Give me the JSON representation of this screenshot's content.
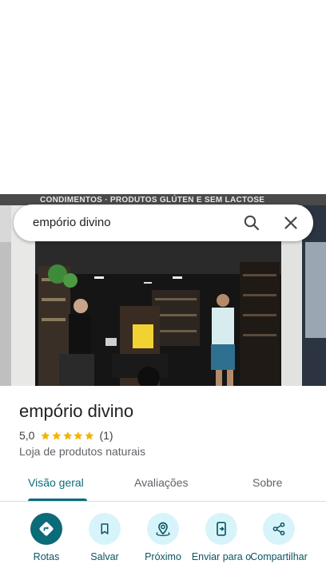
{
  "search": {
    "query": "empório divino"
  },
  "photo": {
    "sign_text": "CONDIMENTOS · PRODUTOS GLÚTEN E SEM LACTOSE"
  },
  "place": {
    "name": "empório divino",
    "rating": "5,0",
    "stars": 5,
    "review_count": "(1)",
    "category": "Loja de produtos naturais"
  },
  "tabs": [
    {
      "label": "Visão geral",
      "active": true
    },
    {
      "label": "Avaliações",
      "active": false
    },
    {
      "label": "Sobre",
      "active": false
    }
  ],
  "actions": [
    {
      "label": "Rotas",
      "icon": "directions-icon"
    },
    {
      "label": "Salvar",
      "icon": "bookmark-icon"
    },
    {
      "label": "Próximo",
      "icon": "nearby-icon"
    },
    {
      "label": "Enviar para o",
      "icon": "send-to-phone-icon"
    },
    {
      "label": "Compartilhar",
      "icon": "share-icon"
    }
  ],
  "colors": {
    "accent": "#0b6b78",
    "action_bg": "#d8f4fb",
    "star": "#f4b400"
  }
}
